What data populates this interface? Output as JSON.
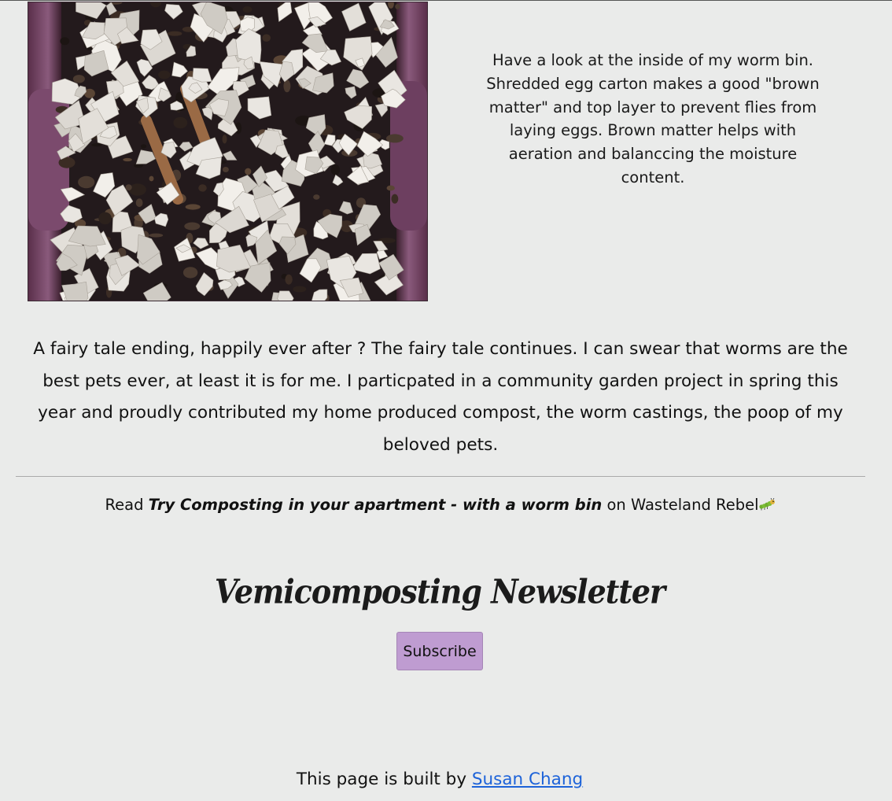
{
  "photo": {
    "subject": "worm bin with shredded egg carton"
  },
  "caption": {
    "text": "Have a look at the inside of my worm bin. Shredded egg carton makes a good \"brown matter\" and top layer to prevent flies from laying eggs. Brown matter helps with aeration and balanccing the moisture content."
  },
  "story": {
    "text": "A fairy tale ending, happily ever after ? The fairy tale continues. I can swear that worms are the best pets ever, at least it is for me. I particpated in a community garden project in spring this year and proudly contributed my home produced compost, the worm castings, the poop of my beloved pets."
  },
  "read_link": {
    "prefix": "Read ",
    "title": "Try Composting in your apartment - with a worm bin",
    "suffix": " on Wasteland Rebel",
    "icon": "caterpillar-icon"
  },
  "newsletter": {
    "title": "Vemicomposting Newsletter",
    "button_label": "Subscribe"
  },
  "footer": {
    "prefix": "This page is built by ",
    "author_link": "Susan Chang"
  },
  "colors": {
    "background": "#eaebea",
    "subscribe_button": "#bf9cd1",
    "link": "#1c62d9"
  }
}
